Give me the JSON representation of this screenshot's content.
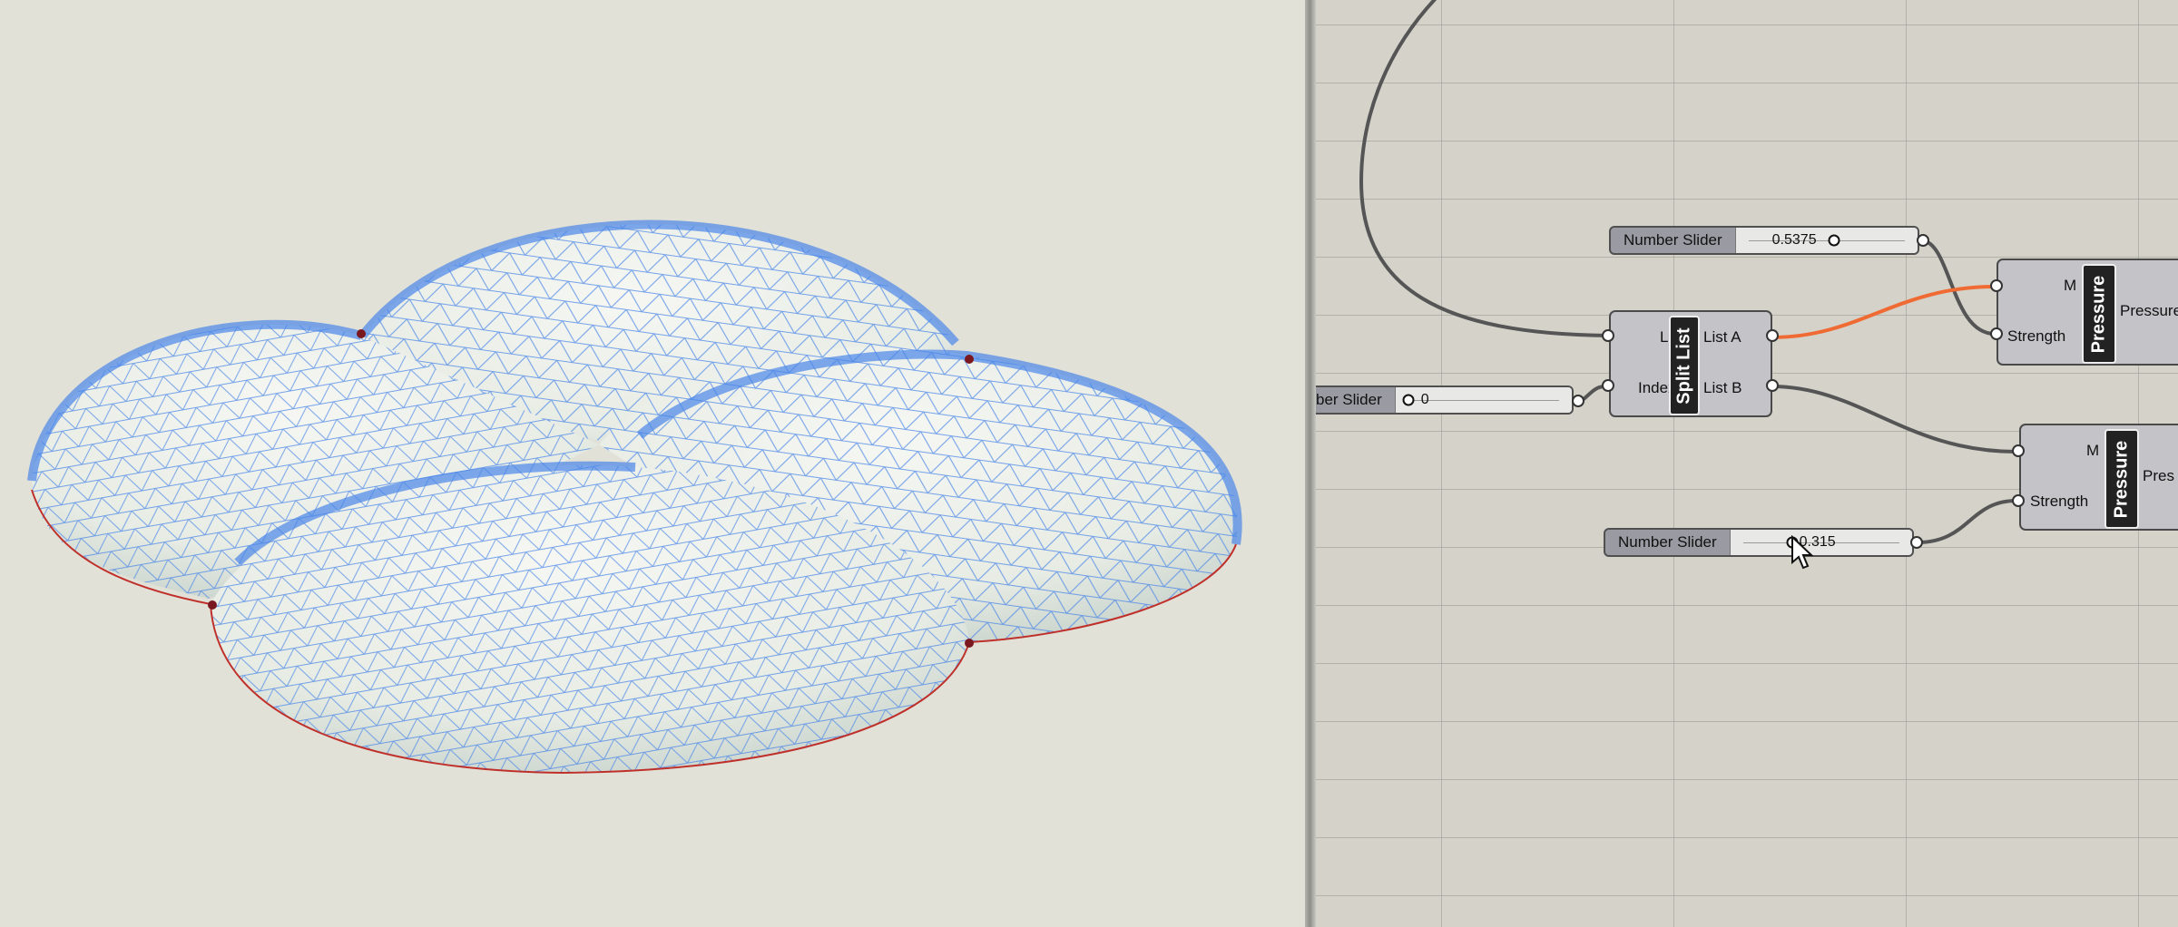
{
  "viewport": {
    "surface_color": "#edf0ea",
    "mesh_color": "#4a86e8",
    "edge_color": "#c0302a"
  },
  "canvas": {
    "wire_color": "#555555",
    "active_wire_color": "#f06a33",
    "slider_top": {
      "label": "Number Slider",
      "value": "0.5375"
    },
    "slider_index": {
      "label": "ber Slider",
      "value": "0"
    },
    "slider_bottom": {
      "label": "Number Slider",
      "value": "0.315"
    },
    "split_list": {
      "name": "Split List",
      "inputs": [
        "List",
        "Index"
      ],
      "outputs": [
        "List A",
        "List B"
      ]
    },
    "pressure_top": {
      "name": "Pressure",
      "inputs": [
        "M",
        "Strength"
      ],
      "output": "Pressure"
    },
    "pressure_bottom": {
      "name": "Pressure",
      "inputs": [
        "M",
        "Strength"
      ],
      "output": "Pres"
    }
  }
}
